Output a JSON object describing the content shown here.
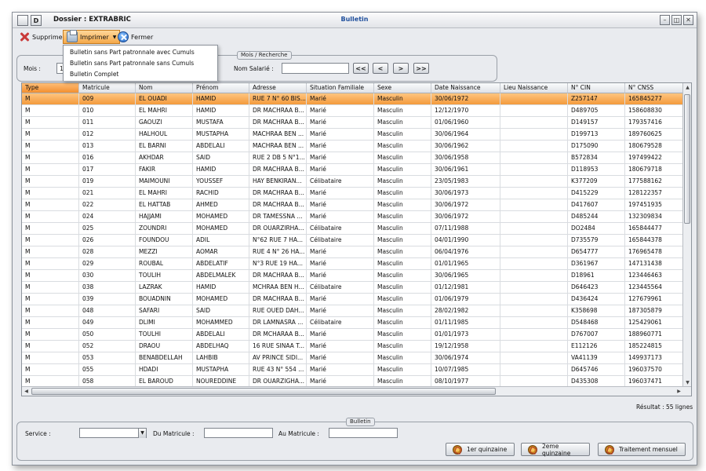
{
  "titlebar": {
    "sys_buttons": [
      "",
      "D"
    ],
    "dossier_label": "Dossier :  EXTRABRIC",
    "title": "Bulletin",
    "controls": [
      "–",
      "◫",
      "✕"
    ]
  },
  "toolbar": {
    "delete_label": "Supprimer",
    "print_label": "Imprimer",
    "close_label": "Fermer"
  },
  "print_menu": {
    "items": [
      "Bulletin sans Part patronnale avec Cumuls",
      "Bulletin sans Part patronnale sans Cumuls",
      "Bulletin Complet"
    ]
  },
  "search_group": {
    "legend": "Mois / Recherche",
    "mois_label": "Mois :",
    "mois_value": "1",
    "nom_salarie_label": "Nom Salarié :",
    "nom_salarie_value": "",
    "nav": [
      "<<",
      "<",
      ">",
      ">>"
    ]
  },
  "grid": {
    "columns": [
      "Type",
      "Matricule",
      "Nom",
      "Prénom",
      "Adresse",
      "Situation Familiale",
      "Sexe",
      "Date Naissance",
      "Lieu Naissance",
      "N° CIN",
      "N° CNSS"
    ],
    "rows": [
      [
        "M",
        "009",
        "EL OUADI",
        "HAMID",
        "RUE 7 N° 60 BIS...",
        "Marié",
        "Masculin",
        "30/06/1972",
        "",
        "Z257147",
        "165845277"
      ],
      [
        "M",
        "010",
        "EL MAHRI",
        "HAMID",
        "DR MACHRAA B...",
        "Marié",
        "Masculin",
        "12/12/1970",
        "",
        "D489705",
        "158608830"
      ],
      [
        "M",
        "011",
        "GAOUZI",
        "MUSTAFA",
        "DR MACHRAA B...",
        "Marié",
        "Masculin",
        "01/06/1960",
        "",
        "D149157",
        "179357416"
      ],
      [
        "M",
        "012",
        "HALHOUL",
        "MUSTAPHA",
        "MACHRAA BEN ...",
        "Marié",
        "Masculin",
        "30/06/1964",
        "",
        "D199713",
        "189760625"
      ],
      [
        "M",
        "013",
        "EL BARNI",
        "ABDELALI",
        "MACHRAA BEN ...",
        "Marié",
        "Masculin",
        "30/06/1962",
        "",
        "D175090",
        "180679528"
      ],
      [
        "M",
        "016",
        "AKHDAR",
        "SAID",
        "RUE 2 DB 5 N°1...",
        "Marié",
        "Masculin",
        "30/06/1958",
        "",
        "B572834",
        "197499422"
      ],
      [
        "M",
        "017",
        "FAKIR",
        "HAMID",
        "DR MACHRAA B...",
        "Marié",
        "Masculin",
        "30/06/1961",
        "",
        "D118953",
        "180679718"
      ],
      [
        "M",
        "019",
        "MAIMOUNI",
        "YOUSSEF",
        "HAY BENKIRAN...",
        "Célibataire",
        "Masculin",
        "23/05/1983",
        "",
        "K377209",
        "177588162"
      ],
      [
        "M",
        "021",
        "EL MAHRI",
        "RACHID",
        "DR MACHRAA B...",
        "Marié",
        "Masculin",
        "30/06/1973",
        "",
        "D415229",
        "128122357"
      ],
      [
        "M",
        "022",
        "EL HATTAB",
        "AHMED",
        "DR MACHRAA B...",
        "Marié",
        "Masculin",
        "30/06/1972",
        "",
        "D417607",
        "197451935"
      ],
      [
        "M",
        "024",
        "HAJJAMI",
        "MOHAMED",
        "DR TAMESSNA ...",
        "Marié",
        "Masculin",
        "30/06/1972",
        "",
        "D485244",
        "132309834"
      ],
      [
        "M",
        "025",
        "ZOUNDRI",
        "MOHAMED",
        "DR OUARZIRHA...",
        "Célibataire",
        "Masculin",
        "07/11/1988",
        "",
        "DO2484",
        "165844477"
      ],
      [
        "M",
        "026",
        "FOUNDOU",
        "ADIL",
        "N°62 RUE 7 HA...",
        "Célibataire",
        "Masculin",
        "04/01/1990",
        "",
        "D735579",
        "165844378"
      ],
      [
        "M",
        "028",
        "MEZZI",
        "AOMAR",
        "RUE 4 N° 26 HA...",
        "Marié",
        "Masculin",
        "06/04/1976",
        "",
        "D654777",
        "176965478"
      ],
      [
        "M",
        "029",
        "ROUBAL",
        "ABDELATIF",
        "N°3  RUE 19 HA...",
        "Marié",
        "Masculin",
        "01/01/1965",
        "",
        "D361967",
        "147131438"
      ],
      [
        "M",
        "030",
        "TOULIH",
        "ABDELMALEK",
        "DR MACHRAA B...",
        "Marié",
        "Masculin",
        "30/06/1965",
        "",
        "D18961",
        "123446463"
      ],
      [
        "M",
        "038",
        "LAZRAK",
        "HAMID",
        "MCHRAA BEN H...",
        "Célibataire",
        "Masculin",
        "01/12/1981",
        "",
        "D646423",
        "123445564"
      ],
      [
        "M",
        "039",
        "BOUADNIN",
        "MOHAMED",
        "DR MACHRAA B...",
        "Marié",
        "Masculin",
        "01/06/1979",
        "",
        "D436424",
        "127679961"
      ],
      [
        "M",
        "048",
        "SAFARI",
        "SAID",
        "RUE OUED DAH...",
        "Marié",
        "Masculin",
        "28/02/1982",
        "",
        "K358698",
        "187305879"
      ],
      [
        "M",
        "049",
        "DLIMI",
        "MOHAMMED",
        "DR LAMNASRA ...",
        "Célibataire",
        "Masculin",
        "01/11/1985",
        "",
        "D548468",
        "125429061"
      ],
      [
        "M",
        "050",
        "TOULHI",
        "ABDELALI",
        "DR MCHARAA B...",
        "Marié",
        "Masculin",
        "01/01/1973",
        "",
        "D767007",
        "188960771"
      ],
      [
        "M",
        "052",
        "DRAOU",
        "ABDELHAQ",
        "16 RUE SINAA T...",
        "Marié",
        "Masculin",
        "19/12/1958",
        "",
        "E112126",
        "185224815"
      ],
      [
        "M",
        "053",
        "BENABDELLAH",
        "LAHBIB",
        "AV PRINCE SIDI...",
        "Marié",
        "Masculin",
        "30/06/1974",
        "",
        "VA41139",
        "149937173"
      ],
      [
        "M",
        "055",
        "HDADI",
        "MUSTAPHA",
        "RUE 43 N° 554 ...",
        "Marié",
        "Masculin",
        "10/07/1985",
        "",
        "D645746",
        "196037570"
      ],
      [
        "M",
        "058",
        "EL BAROUD",
        "NOUREDDINE",
        "DR OUARZIGHA...",
        "Marié",
        "Masculin",
        "08/10/1977",
        "",
        "D435308",
        "196037471"
      ]
    ],
    "selected_index": 0
  },
  "result_text": "Résultat : 55  lignes",
  "bulletin_group": {
    "legend": "Bulletin",
    "service_label": "Service :",
    "service_value": "",
    "du_matricule_label": "Du Matricule :",
    "du_matricule_value": "",
    "au_matricule_label": "Au Matricule :",
    "au_matricule_value": "",
    "btn_q1": "1er quinzaine",
    "btn_q2": "2eme quinzaine",
    "btn_monthly": "Traitement mensuel"
  }
}
